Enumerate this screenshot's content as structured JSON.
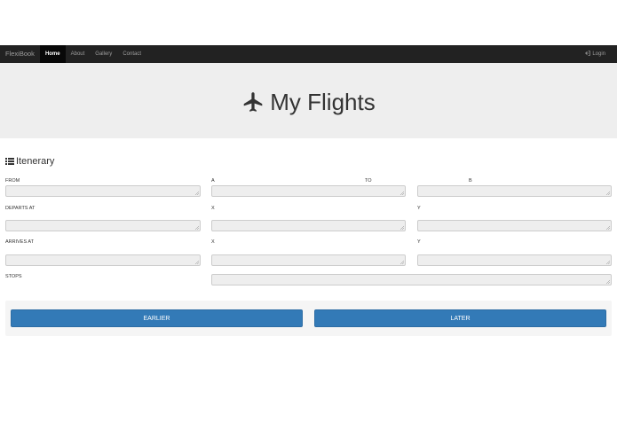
{
  "navbar": {
    "brand": "FlexiBook",
    "items": [
      {
        "label": "Home",
        "active": true
      },
      {
        "label": "About",
        "active": false
      },
      {
        "label": "Gallery",
        "active": false
      },
      {
        "label": "Contact",
        "active": false
      }
    ],
    "login": "Login"
  },
  "jumbotron": {
    "title": "My Flights",
    "icon": "plane-icon"
  },
  "itinerary": {
    "title": "Itenerary",
    "icon": "list-icon",
    "rows": {
      "from": {
        "label": "FROM",
        "a": "A",
        "to": "TO",
        "b": "B"
      },
      "departs": {
        "label": "DEPARTS AT",
        "x": "X",
        "y": "Y"
      },
      "arrives": {
        "label": "ARRIVES AT",
        "x": "X",
        "y": "Y"
      },
      "stops": {
        "label": "STOPS"
      }
    }
  },
  "actions": {
    "earlier": "EARLIER",
    "later": "LATER"
  },
  "colors": {
    "navbar": "#222222",
    "jumbotron": "#eeeeee",
    "primary": "#337ab7"
  }
}
